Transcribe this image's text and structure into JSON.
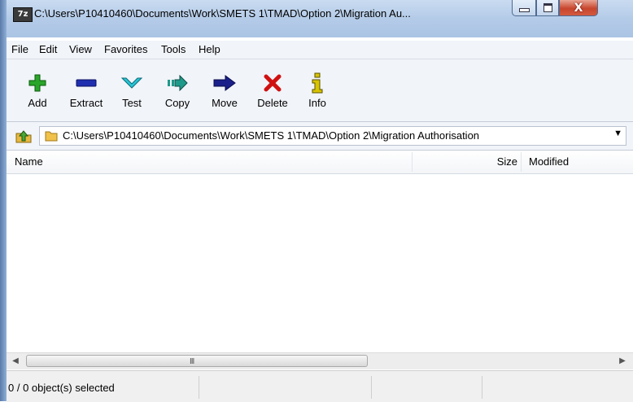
{
  "window": {
    "app_icon_text": "7z",
    "title": "C:\\Users\\P10410460\\Documents\\Work\\SMETS 1\\TMAD\\Option 2\\Migration Au...",
    "close_glyph": "X"
  },
  "menu": {
    "items": [
      {
        "label": "File"
      },
      {
        "label": "Edit"
      },
      {
        "label": "View"
      },
      {
        "label": "Favorites"
      },
      {
        "label": "Tools"
      },
      {
        "label": "Help"
      }
    ]
  },
  "toolbar": {
    "buttons": [
      {
        "label": "Add",
        "icon": "add-icon"
      },
      {
        "label": "Extract",
        "icon": "extract-icon"
      },
      {
        "label": "Test",
        "icon": "test-icon"
      },
      {
        "label": "Copy",
        "icon": "copy-icon"
      },
      {
        "label": "Move",
        "icon": "move-icon"
      },
      {
        "label": "Delete",
        "icon": "delete-icon"
      },
      {
        "label": "Info",
        "icon": "info-icon"
      }
    ]
  },
  "address": {
    "path": "C:\\Users\\P10410460\\Documents\\Work\\SMETS 1\\TMAD\\Option 2\\Migration Authorisation",
    "dropdown_glyph": "▼"
  },
  "columns": {
    "name": "Name",
    "size": "Size",
    "modified": "Modified"
  },
  "scrollbar": {
    "left_arrow": "◀",
    "right_arrow": "▶",
    "grip": "III"
  },
  "status": {
    "text": "0 / 0 object(s) selected"
  },
  "colors": {
    "add": "#2aa52a",
    "extract": "#1f2fb0",
    "test": "#28c6d6",
    "copy": "#1f9a8a",
    "move": "#1a1f8a",
    "delete": "#d01010",
    "info": "#d8c400"
  }
}
